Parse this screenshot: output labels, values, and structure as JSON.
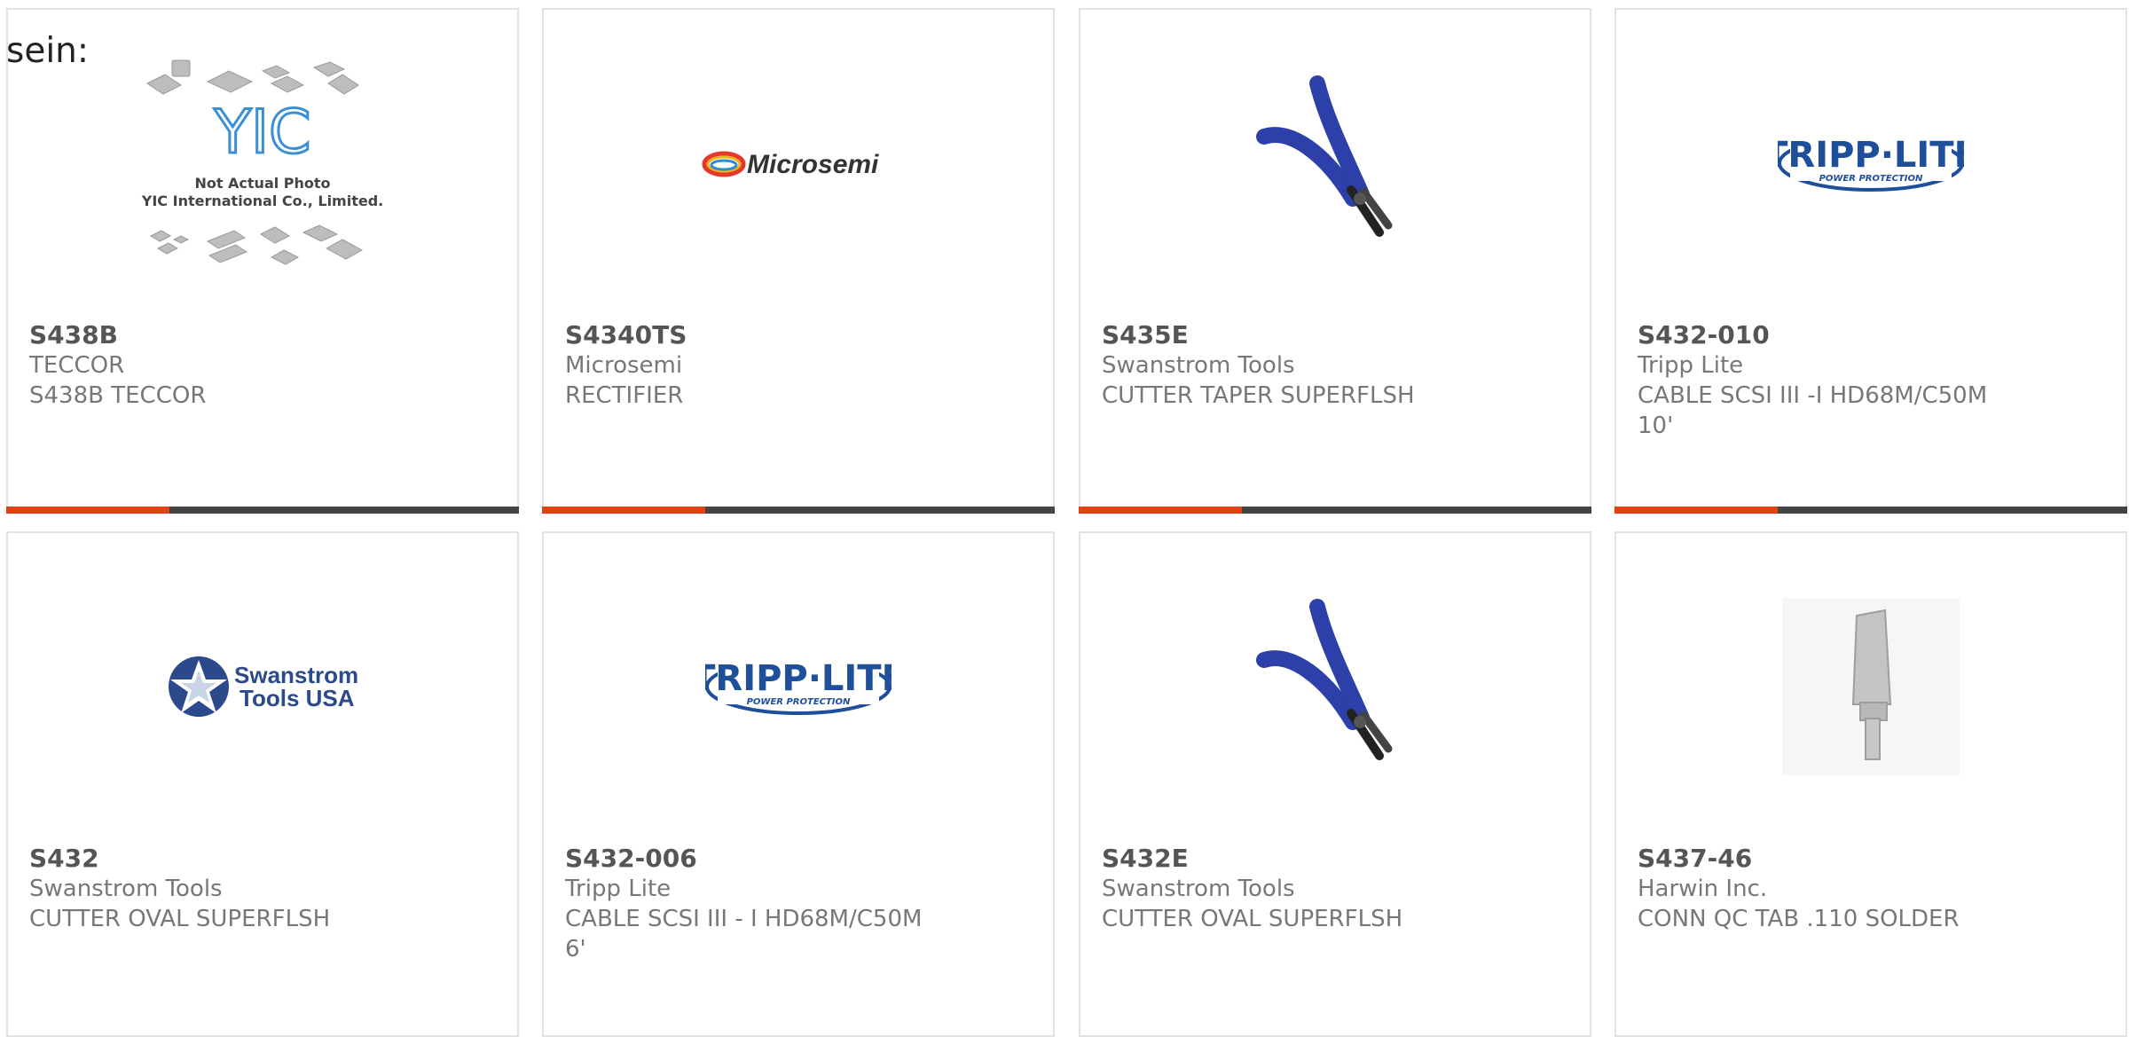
{
  "heading": "sein:",
  "colors": {
    "accent": "#e34113",
    "bar": "#444444",
    "border": "#e2e2e2",
    "part_number": "#555555",
    "text": "#777777",
    "tripplite_blue": "#1f4e9b",
    "swanstrom_blue": "#2b4a8b",
    "pliers_blue": "#2d3fa8"
  },
  "products": [
    {
      "part_number": "S438B",
      "manufacturer": "TECCOR",
      "description": "S438B TECCOR",
      "image": "yic-placeholder-icon",
      "placeholder_line1": "Not Actual Photo",
      "placeholder_line2": "YIC International Co., Limited.",
      "placeholder_logo": "YIC"
    },
    {
      "part_number": "S4340TS",
      "manufacturer": "Microsemi",
      "description": "RECTIFIER",
      "image": "microsemi-logo",
      "logo_text": "Microsemi"
    },
    {
      "part_number": "S435E",
      "manufacturer": "Swanstrom Tools",
      "description": "CUTTER TAPER SUPERFLSH",
      "image": "pliers-icon"
    },
    {
      "part_number": "S432-010",
      "manufacturer": "Tripp Lite",
      "description": "CABLE SCSI III -I HD68M/C50M 10'",
      "image": "tripp-lite-logo",
      "logo_text": "TRIPP·LITE",
      "logo_subtext": "POWER PROTECTION"
    },
    {
      "part_number": "S432",
      "manufacturer": "Swanstrom Tools",
      "description": "CUTTER OVAL SUPERFLSH",
      "image": "swanstrom-logo",
      "logo_text_line1": "Swanstrom",
      "logo_text_line2": "Tools USA"
    },
    {
      "part_number": "S432-006",
      "manufacturer": "Tripp Lite",
      "description": "CABLE SCSI III - I HD68M/C50M 6'",
      "image": "tripp-lite-logo",
      "logo_text": "TRIPP·LITE",
      "logo_subtext": "POWER PROTECTION"
    },
    {
      "part_number": "S432E",
      "manufacturer": "Swanstrom Tools",
      "description": "CUTTER OVAL SUPERFLSH",
      "image": "pliers-icon"
    },
    {
      "part_number": "S437-46",
      "manufacturer": "Harwin Inc.",
      "description": "CONN QC TAB .110 SOLDER",
      "image": "connector-tab-icon"
    }
  ]
}
